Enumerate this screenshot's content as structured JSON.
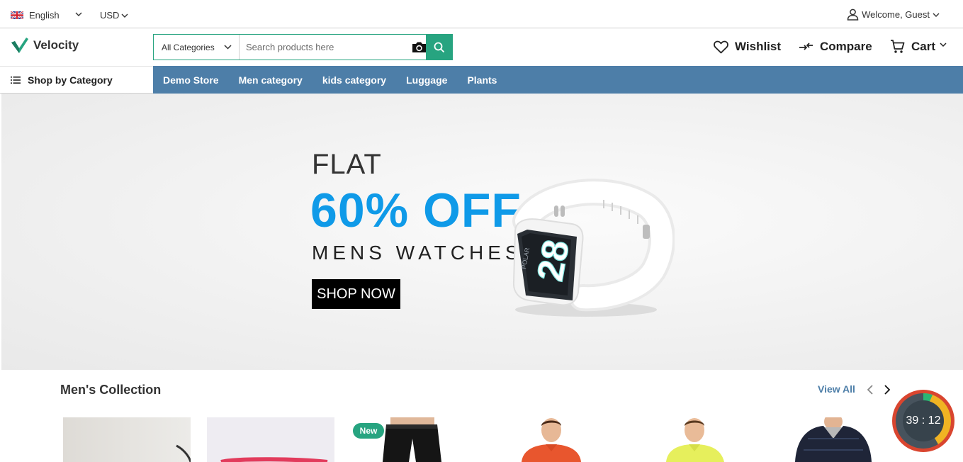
{
  "topbar": {
    "language": "English",
    "currency": "USD",
    "welcome": "Welcome, Guest"
  },
  "header": {
    "logo_text": "Velocity",
    "category_select": "All Categories",
    "search_placeholder": "Search products here",
    "wishlist": "Wishlist",
    "compare": "Compare",
    "cart": "Cart"
  },
  "nav": {
    "shop_by_category": "Shop by Category",
    "items": [
      "Demo Store",
      "Men category",
      "kids category",
      "Luggage",
      "Plants"
    ]
  },
  "banner": {
    "line1": "FLAT",
    "line2": "60% OFF",
    "line3": "MENS WATCHES",
    "cta": "SHOP NOW",
    "watch_brand": "POLAR",
    "watch_time": "28"
  },
  "collection": {
    "title": "Men's Collection",
    "view_all": "View All",
    "badge_new": "New"
  },
  "timer": {
    "text": "39 : 12"
  },
  "colors": {
    "accent_green": "#27a480",
    "nav_blue": "#4d7ea8",
    "banner_blue": "#0f9ae8"
  }
}
